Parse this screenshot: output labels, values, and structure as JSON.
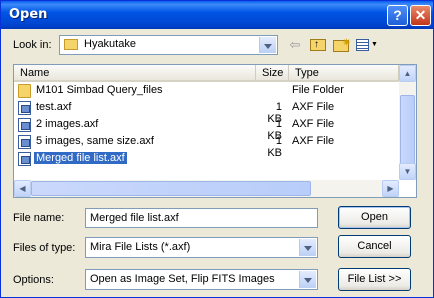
{
  "window": {
    "title": "Open"
  },
  "titlebar": {
    "help_glyph": "?",
    "close_glyph": "✕"
  },
  "lookin": {
    "label": "Look in:",
    "value": "Hyakutake"
  },
  "toolbar": {
    "icons": [
      "back-arrow-icon",
      "up-folder-icon",
      "new-folder-icon",
      "view-menu-icon"
    ]
  },
  "list": {
    "columns": {
      "name": "Name",
      "size": "Size",
      "type": "Type"
    },
    "rows": [
      {
        "name": "M101 Simbad Query_files",
        "size": "",
        "type": "File Folder",
        "icon": "folder"
      },
      {
        "name": "test.axf",
        "size": "1 KB",
        "type": "AXF File",
        "icon": "file"
      },
      {
        "name": "2 images.axf",
        "size": "1 KB",
        "type": "AXF File",
        "icon": "file"
      },
      {
        "name": "5 images, same size.axf",
        "size": "1 KB",
        "type": "AXF File",
        "icon": "file"
      },
      {
        "name": "Merged file list.axf",
        "size": "1 KB",
        "type": "AXF File",
        "icon": "file",
        "selected": true
      }
    ]
  },
  "filename": {
    "label": "File name:",
    "value": "Merged file list.axf"
  },
  "filetype": {
    "label": "Files of type:",
    "value": "Mira File Lists  (*.axf)"
  },
  "options": {
    "label": "Options:",
    "value": "Open as Image Set, Flip FITS Images"
  },
  "buttons": {
    "open": "Open",
    "cancel": "Cancel",
    "filelist": "File List >>"
  }
}
